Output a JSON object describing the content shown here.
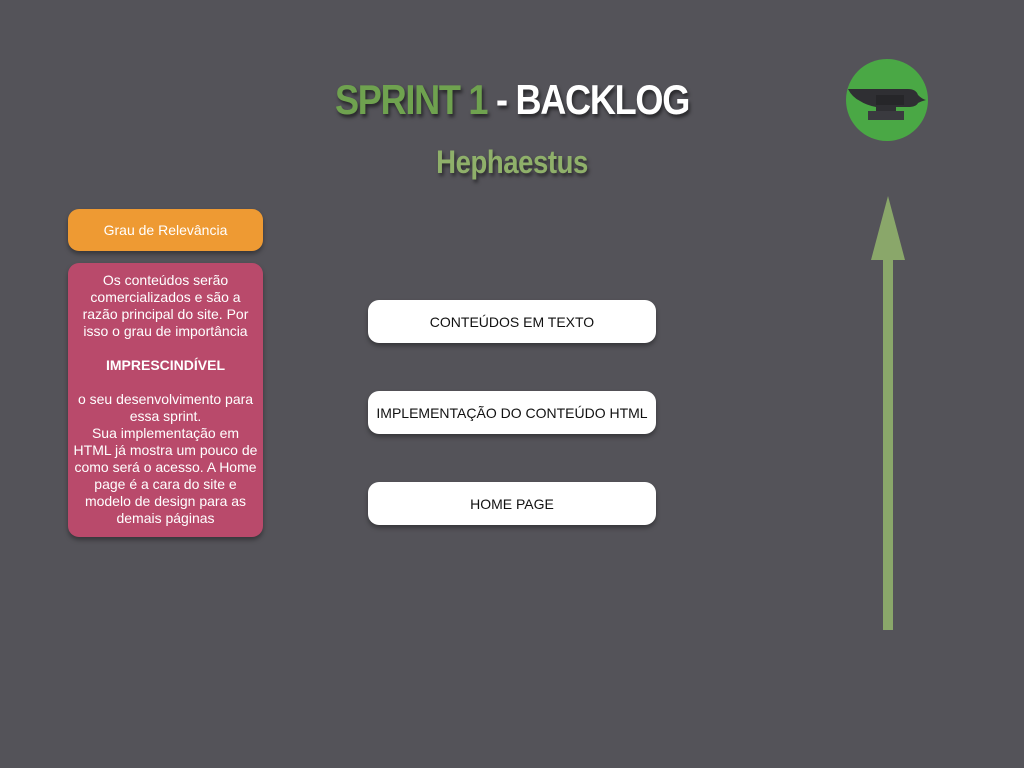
{
  "header": {
    "title_part1": "SPRINT 1",
    "title_part2": " - BACKLOG",
    "subtitle": "Hephaestus"
  },
  "logo": {
    "icon": "anvil-icon",
    "background_color": "#4aa845"
  },
  "relevance": {
    "label": "Grau de Relevância",
    "color": "#ee9a33"
  },
  "info_card": {
    "color": "#b94a6b",
    "paragraph1": "Os conteúdos serão comercializados e são a razão principal do site. Por isso o grau de importância",
    "highlight": "IMPRESCINDÍVEL",
    "paragraph2": "o  seu desenvolvimento para essa sprint.",
    "paragraph3": "Sua implementação em HTML já mostra um pouco de como será o acesso. A Home page é a cara do site e modelo de design para as demais páginas"
  },
  "backlog_items": [
    {
      "label": "CONTEÚDOS EM TEXTO"
    },
    {
      "label": "IMPLEMENTAÇÃO DO CONTEÚDO HTML"
    },
    {
      "label": "HOME PAGE"
    }
  ],
  "priority_arrow": {
    "icon": "up-arrow-icon",
    "color": "#8aa76a"
  },
  "colors": {
    "background": "#545359",
    "title_green": "#6fa24f",
    "subtitle_green": "#8fb06a"
  }
}
